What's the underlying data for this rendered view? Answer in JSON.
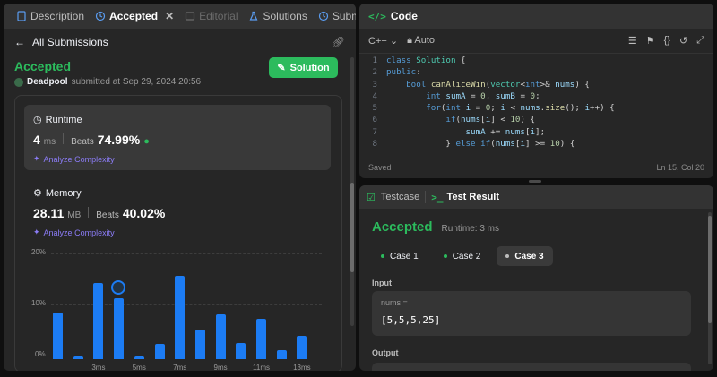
{
  "tabs": {
    "description": "Description",
    "accepted": "Accepted",
    "editorial": "Editorial",
    "solutions": "Solutions",
    "submissions": "Subm"
  },
  "subhead": {
    "back_label": "All Submissions"
  },
  "submission": {
    "status": "Accepted",
    "user": "Deadpool",
    "submitted_text": "submitted at Sep 29, 2024 20:56",
    "solution_button": "Solution"
  },
  "runtime": {
    "title": "Runtime",
    "value": "4",
    "unit": "ms",
    "beats_label": "Beats",
    "beats_value": "74.99%",
    "analyze": "Analyze Complexity"
  },
  "memory": {
    "title": "Memory",
    "value": "28.11",
    "unit": "MB",
    "beats_label": "Beats",
    "beats_value": "40.02%",
    "analyze": "Analyze Complexity"
  },
  "chart_data": {
    "type": "bar",
    "ylabels": [
      "20%",
      "10%",
      "0%"
    ],
    "ylim": [
      0,
      20
    ],
    "x_ticks": [
      "3ms",
      "5ms",
      "7ms",
      "9ms",
      "11ms",
      "13ms"
    ],
    "values": [
      9.4,
      0.6,
      15.4,
      12.3,
      0.5,
      3.1,
      16.9,
      6.0,
      9.1,
      3.3,
      8.2,
      1.8,
      4.7
    ],
    "highlight_index": 3,
    "color": "#1c7cf4"
  },
  "code": {
    "header": "Code",
    "language": "C++",
    "mode": "Auto",
    "lines": [
      [
        "1",
        "class Solution {"
      ],
      [
        "2",
        "public:"
      ],
      [
        "3",
        "    bool canAliceWin(vector<int>& nums) {"
      ],
      [
        "4",
        "        int sumA = 0, sumB = 0;"
      ],
      [
        "5",
        "        for(int i = 0; i < nums.size(); i++) {"
      ],
      [
        "6",
        "            if(nums[i] < 10) {"
      ],
      [
        "7",
        "                sumA += nums[i];"
      ],
      [
        "8",
        "            } else if(nums[i] >= 10) {"
      ]
    ],
    "saved": "Saved",
    "cursor": "Ln 15, Col 20"
  },
  "test": {
    "tab_testcase": "Testcase",
    "tab_result": "Test Result",
    "status": "Accepted",
    "runtime": "Runtime: 3 ms",
    "cases": [
      "Case 1",
      "Case 2",
      "Case 3"
    ],
    "input_label": "Input",
    "input_name": "nums =",
    "input_value": "[5,5,5,25]",
    "output_label": "Output"
  }
}
